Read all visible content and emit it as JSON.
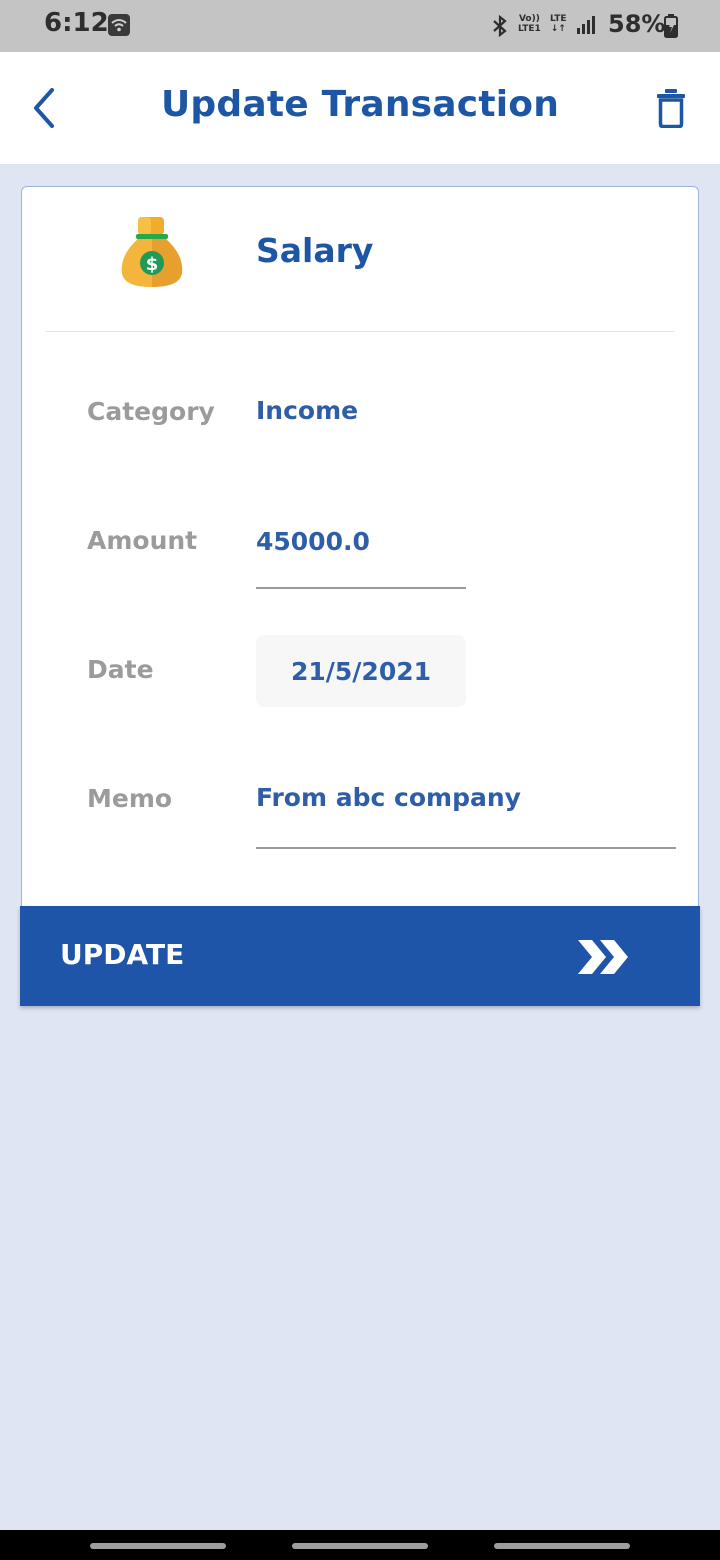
{
  "status_bar": {
    "time": "6:12",
    "network_top": "Vo))",
    "network_bottom": "LTE1",
    "lte_top": "LTE",
    "lte_bottom": "↓↑",
    "battery": "58%"
  },
  "app_bar": {
    "title": "Update Transaction"
  },
  "transaction": {
    "name": "Salary",
    "icon": "money-bag-icon",
    "fields": {
      "category_label": "Category",
      "category_value": "Income",
      "amount_label": "Amount",
      "amount_value": "45000.0",
      "date_label": "Date",
      "date_value": "21/5/2021",
      "memo_label": "Memo",
      "memo_value": "From abc company"
    }
  },
  "update_button": {
    "label": "UPDATE",
    "icon": "double-chevron-right-icon"
  },
  "colors": {
    "accent": "#1e56a6",
    "background": "#dfe5f3",
    "button": "#1e55a8"
  }
}
